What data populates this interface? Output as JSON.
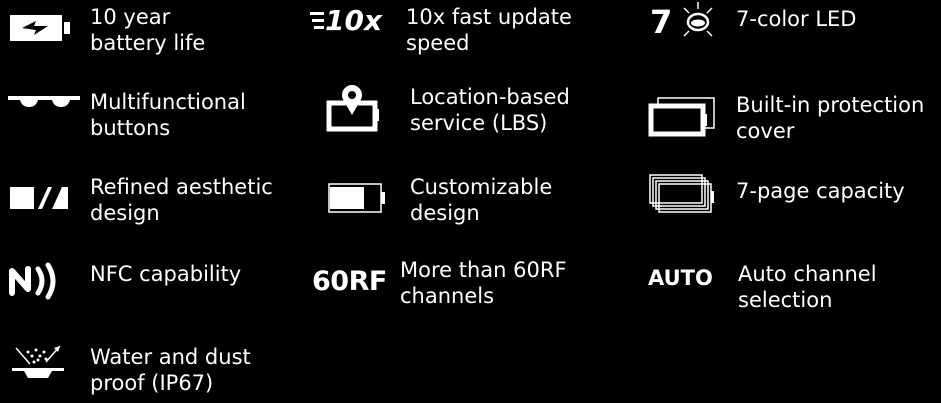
{
  "colors": {
    "background": "#000000",
    "foreground": "#ffffff"
  },
  "features": {
    "battery": {
      "icon": "battery-icon",
      "line1": "10 year",
      "line2": "battery life"
    },
    "buttons": {
      "icon": "buttons-icon",
      "line1": "Multifunctional",
      "line2": "buttons"
    },
    "design": {
      "icon": "aesthetic-design-icon",
      "line1": "Refined aesthetic",
      "line2": "design"
    },
    "nfc": {
      "icon": "nfc-icon",
      "line1": "NFC capability"
    },
    "waterproof": {
      "icon": "water-dust-proof-icon",
      "line1": "Water and dust",
      "line2": "proof (IP67)"
    },
    "update": {
      "icon": "fast-update-icon",
      "badge": "10x",
      "line1": "10x fast update",
      "line2": "speed"
    },
    "lbs": {
      "icon": "location-pin-icon",
      "line1": "Location-based",
      "line2": "service (LBS)"
    },
    "custom": {
      "icon": "customizable-display-icon",
      "line1": "Customizable",
      "line2": "design"
    },
    "rf": {
      "icon": "rf-channels-icon",
      "badge": "60RF",
      "line1": "More than 60RF",
      "line2": "channels"
    },
    "led": {
      "icon": "led-light-icon",
      "badge": "7",
      "line1": "7-color LED"
    },
    "cover": {
      "icon": "protection-cover-icon",
      "line1": "Built-in protection",
      "line2": "cover"
    },
    "pages": {
      "icon": "stacked-pages-icon",
      "line1": "7-page capacity"
    },
    "auto": {
      "icon": "auto-channel-icon",
      "badge": "AUTO",
      "line1": "Auto channel",
      "line2": "selection"
    }
  }
}
